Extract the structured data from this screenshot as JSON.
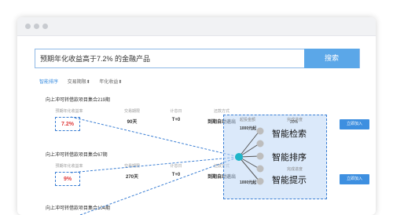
{
  "search": {
    "value": "预期年化收益高于7.2% 的金融产品",
    "button": "搜索"
  },
  "tabs": [
    "智能排序",
    "交易期限⬍",
    "年化收益⬍"
  ],
  "product1": {
    "title": "向上冲可转借款项目集合219期",
    "rate_label": "预期年化收益率",
    "rate": "7.2%",
    "term_label": "交易期限",
    "term": "90天",
    "settle_label": "计息日",
    "settle": "T+0",
    "repay_label": "还款方式",
    "repay": "到期自动退出",
    "start_label": "起投金额",
    "start": "1000元起",
    "pct": "20%",
    "progress_label": "完成进度",
    "invest": "立即加入"
  },
  "product2": {
    "title": "向上冲可转借款项目集合67期",
    "rate_label": "预期年化收益率",
    "rate": "9%",
    "term_label": "交易期限",
    "term": "270天",
    "settle_label": "计息日",
    "settle": "T+0",
    "repay_label": "还款方式",
    "repay": "到期自动退出",
    "start_label": "起投金额",
    "start": "1000元起",
    "progress_label": "完成进度",
    "invest": "立即加入"
  },
  "product3": {
    "title": "向上冲可转借款项目集合104期"
  },
  "features": [
    "智能检索",
    "智能排序",
    "智能提示"
  ]
}
